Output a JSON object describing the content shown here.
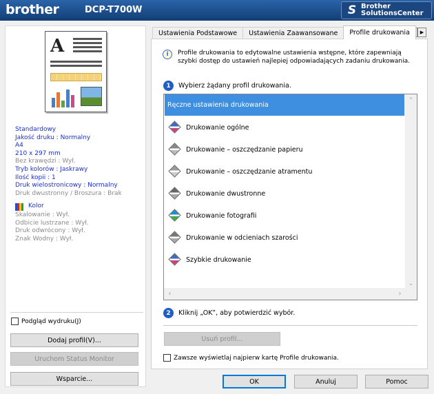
{
  "header": {
    "brand": "brother",
    "model": "DCP-T700W",
    "solutions_line1": "Brother",
    "solutions_line2": "SolutionsCenter"
  },
  "left": {
    "settings": [
      {
        "text": "Standardowy",
        "style": "blue"
      },
      {
        "text": "Jakość druku : Normalny",
        "style": "blue"
      },
      {
        "text": "A4",
        "style": "blue"
      },
      {
        "text": "210 x 297 mm",
        "style": "blue"
      },
      {
        "text": "Bez krawędzi : Wył.",
        "style": "gray"
      },
      {
        "text": "Tryb kolorów : Jaskrawy",
        "style": "blue"
      },
      {
        "text": "Ilość kopii   : 1",
        "style": "blue"
      },
      {
        "text": "Druk wielostronicowy  : Normalny",
        "style": "blue"
      },
      {
        "text": "Druk dwustronny / Broszura : Brak",
        "style": "gray"
      }
    ],
    "color_label": "Kolor",
    "color_settings": [
      "Skalowanie : Wył.",
      "Odbicie lustrzane  : Wył.",
      "Druk odwrócony  : Wył.",
      "Znak Wodny : Wył."
    ],
    "preview_checkbox": "Podgląd wydruku(J)",
    "add_profile": "Dodaj profil(V)...",
    "status_monitor": "Uruchom Status Monitor",
    "support": "Wsparcie..."
  },
  "tabs": [
    "Ustawienia Podstawowe",
    "Ustawienia Zaawansowane",
    "Profile drukowania"
  ],
  "active_tab": 2,
  "main": {
    "info_text": "Profile drukowania to edytowalne ustawienia wstępne, które zapewniają szybki dostęp do ustawień najlepiej odpowiadających zadaniu drukowania.",
    "step1_num": "1",
    "step1": "Wybierz żądany profil drukowania.",
    "profiles": [
      "Ręczne ustawienia drukowania",
      "Drukowanie ogólne",
      "Drukowanie – oszczędzanie papieru",
      "Drukowanie – oszczędzanie atramentu",
      "Drukowanie dwustronne",
      "Drukowanie fotografii",
      "Drukowanie w odcieniach szarości",
      "Szybkie drukowanie"
    ],
    "selected_profile": 0,
    "step2_num": "2",
    "step2": "Kliknij „OK”, aby potwierdzić wybór.",
    "delete_profile": "Usuń profil...",
    "always_show": "Zawsze wyświetlaj najpierw kartę Profile drukowania."
  },
  "footer": {
    "ok": "OK",
    "cancel": "Anuluj",
    "help": "Pomoc"
  },
  "colors": {
    "header": "#1b4f8f",
    "selection": "#3e8fe0",
    "setting_blue": "#1a2fd0",
    "setting_gray": "#8a8a8a"
  }
}
